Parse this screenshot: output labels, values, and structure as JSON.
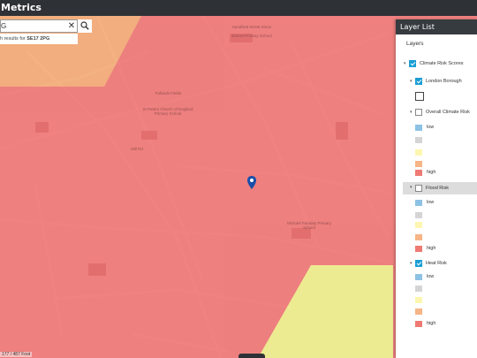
{
  "app": {
    "title": "Metrics"
  },
  "search": {
    "value": "G",
    "hint_prefix": "h results for",
    "hint_query": "SE17 2PG"
  },
  "map": {
    "labels": [
      "Sandford Street Sinon",
      "Barrett Primary School",
      "Pollards Fields",
      "St Peters Church of England Primary School",
      "Mill Rd",
      "Michael Faraday Primary School"
    ],
    "scale": "177 / 487 Foot"
  },
  "layer_list": {
    "title": "Layer List",
    "heading": "Layers",
    "items": [
      {
        "label": "Climate Risk Scores",
        "checked": true
      },
      {
        "label": "London Borough",
        "checked": true
      },
      {
        "label": "Overall Climate Risk",
        "checked": false
      },
      {
        "label": "Flood Risk",
        "checked": false
      },
      {
        "label": "Heat Risk",
        "checked": true
      }
    ],
    "legend_low": "low",
    "legend_high": "high"
  },
  "colors": {
    "zone_high": "#ef6e6e",
    "zone_medium": "#f4a66f",
    "zone_low": "#efed86",
    "legend": [
      "#8cc2e4",
      "#d5d5d5",
      "#fdf6b0",
      "#f7b486",
      "#ef7a74"
    ],
    "checkbox_on": "#1a9ed4"
  }
}
